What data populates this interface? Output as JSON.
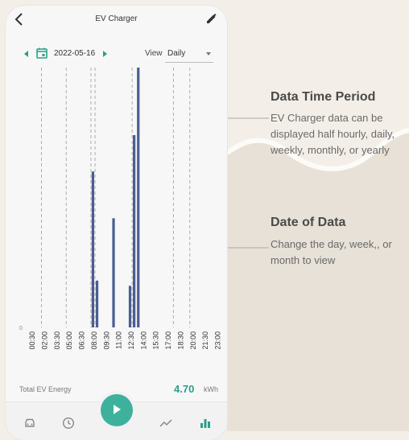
{
  "app": {
    "title": "EV Charger"
  },
  "date_bar": {
    "date": "2022-05-16",
    "view_label": "View",
    "view_value": "Daily"
  },
  "chart_data": {
    "type": "bar",
    "x_tick_labels": [
      "00:30",
      "02:00",
      "03:30",
      "05:00",
      "06:30",
      "08:00",
      "09:30",
      "11:00",
      "12:30",
      "14:00",
      "15:30",
      "17:00",
      "18:30",
      "20:00",
      "21:30",
      "23:00"
    ],
    "y_zero_label": "0",
    "series": [
      {
        "values": [
          0,
          0,
          0,
          0,
          0,
          0,
          0,
          0,
          0,
          0,
          0,
          0,
          0,
          0,
          0,
          0,
          0.6,
          0.18,
          0,
          0,
          0,
          0.42,
          0,
          0,
          0,
          0.16,
          0.74,
          1.0,
          0,
          0,
          0,
          0,
          0,
          0,
          0,
          0,
          0,
          0,
          0,
          0,
          0,
          0,
          0,
          0,
          0,
          0,
          0,
          0
        ]
      }
    ],
    "vertical_lines": {
      "dashed": [
        4,
        10,
        16,
        17,
        26,
        36,
        40
      ]
    },
    "color": "#4a5d93"
  },
  "summary": {
    "label": "Total EV Energy",
    "value": "4.70",
    "unit": "kWh"
  },
  "nav": {
    "items": [
      "car-icon",
      "clock-icon",
      "play-icon",
      "trend-icon",
      "bar-chart-icon"
    ]
  },
  "callouts": [
    {
      "title": "Data Time Period",
      "lines": [
        "EV Charger data can be",
        "displayed half hourly, daily,",
        "weekly, monthly, or yearly"
      ]
    },
    {
      "title": "Date of Data",
      "lines": [
        "Change the day, week,, or",
        "month to view"
      ]
    }
  ],
  "colors": {
    "accent": "#27a08a",
    "bar": "#4a5d93"
  }
}
